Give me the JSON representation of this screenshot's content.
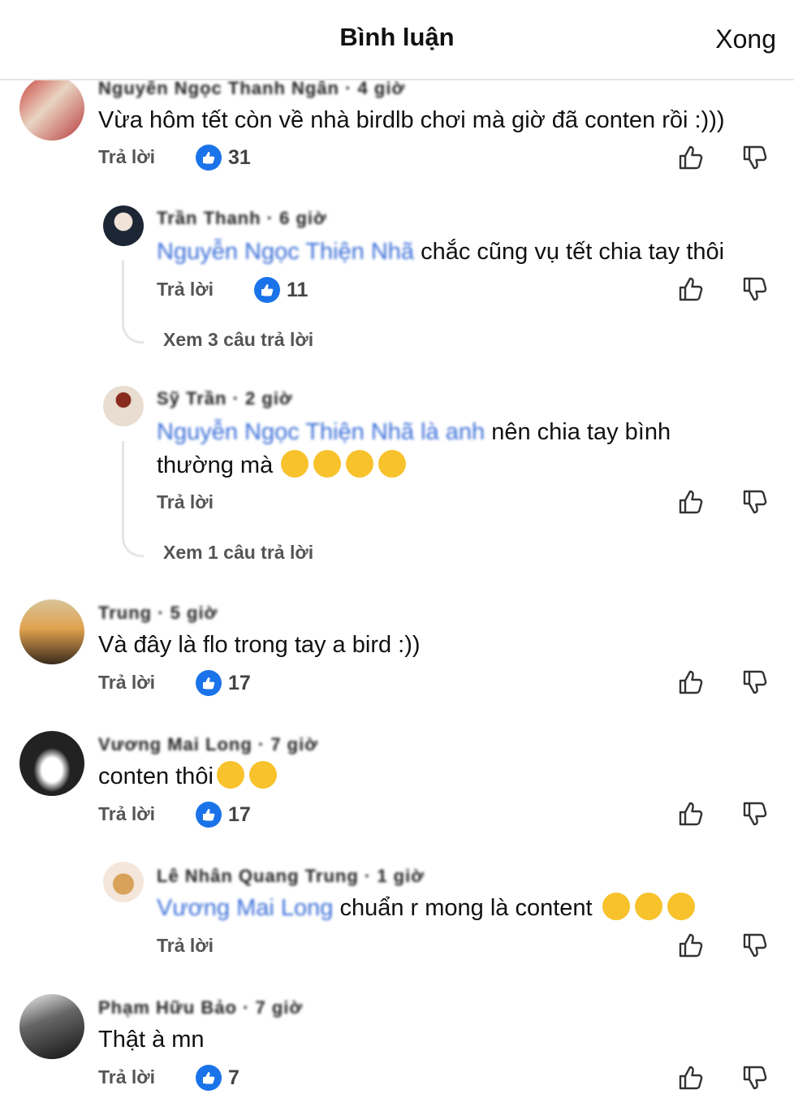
{
  "header": {
    "title": "Bình luận",
    "done_label": "Xong"
  },
  "reply_label": "Trả lời",
  "comments": [
    {
      "name": "Nguyễn Ngọc Thanh Ngân · 4 giờ",
      "text": "Vừa hôm tết còn về nhà birdlb chơi mà giờ đã conten rồi :)))",
      "likes": "31"
    },
    {
      "name": "Trần Thanh · 6 giờ",
      "mention": "Nguyễn Ngọc Thiện Nhã",
      "text": " chắc cũng vụ tết chia tay thôi",
      "likes": "11",
      "view_more": "Xem 3 câu trả lời"
    },
    {
      "name": "Sỹ Trần · 2 giờ",
      "mention": "Nguyễn Ngọc Thiện Nhã là anh ",
      "text_line1": "nên chia tay bình",
      "text_line2": "thường mà",
      "view_more": "Xem 1 câu trả lời"
    },
    {
      "name": "Trung · 5 giờ",
      "text": "Và đây là flo trong tay a bird :))",
      "likes": "17"
    },
    {
      "name": "Vương Mai Long · 7 giờ",
      "text": "conten thôi",
      "likes": "17"
    },
    {
      "name": "Lê Nhân Quang Trung · 1 giờ",
      "mention": "Vương Mai Long ",
      "text": "chuẩn r mong là content"
    },
    {
      "name": "Phạm Hữu Bảo · 7 giờ",
      "text": "Thật à mn",
      "likes": "7"
    }
  ],
  "colors": {
    "like_blue": "#1a73e8",
    "mention_blue": "#3b6fd8",
    "emoji_yellow": "#f7c22b"
  }
}
